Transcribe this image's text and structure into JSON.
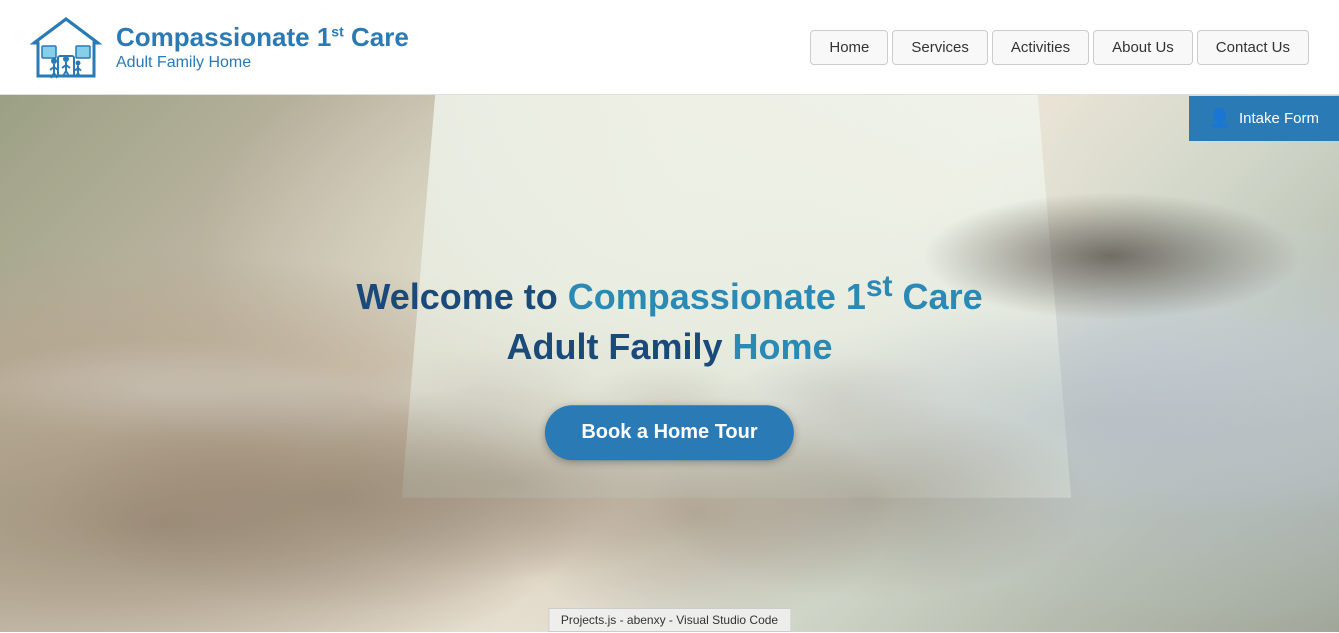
{
  "header": {
    "logo": {
      "title_part1": "Compassionate 1",
      "title_sup": "st",
      "title_part2": " Care",
      "subtitle": "Adult Family Home"
    },
    "nav": {
      "items": [
        {
          "label": "Home",
          "id": "home"
        },
        {
          "label": "Services",
          "id": "services"
        },
        {
          "label": "Activities",
          "id": "activities"
        },
        {
          "label": "About Us",
          "id": "about"
        },
        {
          "label": "Contact Us",
          "id": "contact"
        }
      ]
    }
  },
  "intake": {
    "label": "Intake Form"
  },
  "hero": {
    "title_line1_prefix": "Welcome to Compassionate 1",
    "title_line1_sup": "st",
    "title_line1_suffix": " Care",
    "title_line2": "Adult Family Home",
    "button_label": "Book a Home Tour"
  },
  "taskbar": {
    "label": "Projects.js - abenxy - Visual Studio Code"
  },
  "colors": {
    "brand_blue": "#2a7ab5",
    "dark_blue": "#1a4a7a",
    "intake_bg": "#2a7ab5"
  }
}
